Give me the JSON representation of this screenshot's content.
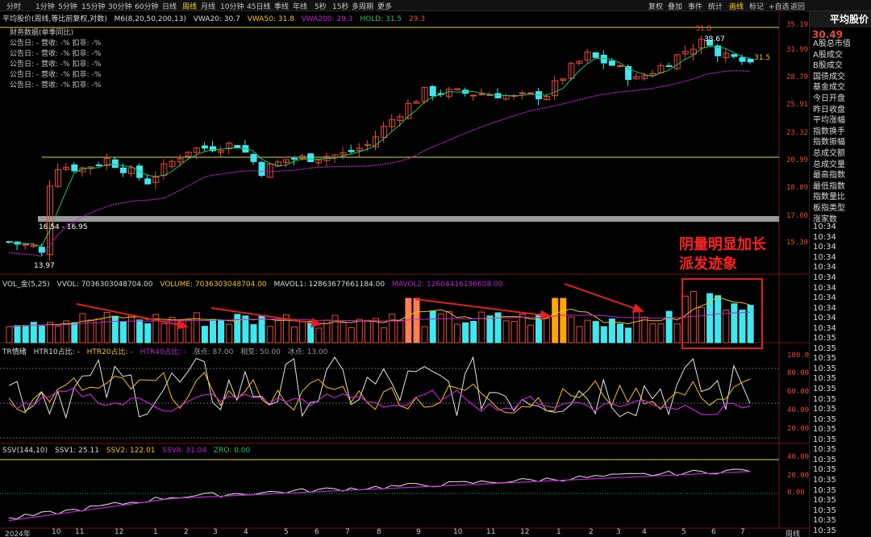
{
  "toolbar": {
    "left": [
      "分时",
      "1分钟",
      "5分钟",
      "15分钟",
      "30分钟",
      "60分钟",
      "日线",
      "周线",
      "月线",
      "10分钟",
      "45日线",
      "季线",
      "年线",
      "5秒",
      "15秒",
      "多周期",
      "更多"
    ],
    "active": "周线",
    "right": [
      "复权",
      "叠加",
      "事件",
      "统计",
      "画线",
      "标记",
      "+自选",
      "返回"
    ]
  },
  "main": {
    "title": "平均股价(周线,等比前复权,对数)",
    "indicator": "M6(8,20,50,200,13)",
    "vwa20": "VWA20: 30.7",
    "vwa50": "VWA50: 31.8",
    "vwa200": "VWA200: 29.3",
    "hold": "HOLD: 31.5",
    "extra": "29.3",
    "fin_header": "财务数据(单季同比)",
    "fin_rows": [
      "公告日: -    营收: -%    扣非: -%",
      "公告日: -    营收: -%    扣非: -%",
      "公告日: -    营收: -%    扣非: -%",
      "公告日: -    营收: -%    扣非: -%",
      "公告日: -    营收: -%    扣非: -%"
    ],
    "range_label": "16.54 - 16.95",
    "low_label": "13.97",
    "high_label": "31.8",
    "high2_label": "33.67",
    "last_label": "31.5",
    "price_axis": [
      "35.19",
      "31.99",
      "28.79",
      "25.91",
      "23.32",
      "20.99",
      "18.89",
      "17.00",
      "15.30"
    ]
  },
  "volume": {
    "title": "VOL_金(5,25)",
    "vvol": "VVOL: 7036303048704.00",
    "volume": "VOLUME: 7036303048704.00",
    "mavol1": "MAVOL1: 12863677661184.00",
    "mavol2": "MAVOL2: 12604416196608.00"
  },
  "tr": {
    "title": "TR情绪",
    "h10": "HTR10占比: -",
    "h20": "HTR20占比: -",
    "h40": "HTR40占比: -",
    "up": "涨点: 87.00",
    "mid": "相变: 50.00",
    "ice": "冰点: 13.00",
    "axis": [
      "100.0",
      "80.00",
      "60.00",
      "40.00",
      "20.00"
    ]
  },
  "ssv": {
    "title": "SSV(144,10)",
    "ssv1": "SSV1: 25.11",
    "ssv2": "SSV2: 122.01",
    "ssva": "SSVA: 31.04",
    "zro": "ZRO: 0.00",
    "axis": [
      "40.00",
      "20.00",
      "0.00"
    ]
  },
  "annotation": {
    "line1": "阴量明显加长",
    "line2": "派发迹象"
  },
  "right_panel": {
    "title": "平均股价",
    "price": "30.49",
    "items": [
      "A股总市值",
      "A股成交",
      "B股成交",
      "国债成交",
      "基金成交",
      "今日开盘",
      "昨日收盘",
      "平均涨幅",
      "指数换手",
      "指数振幅",
      "总成交额",
      "总成交量",
      "最高指数",
      "最低指数",
      "指数量比",
      "板指类型",
      "涨家数"
    ],
    "times": [
      "10:34",
      "10:34",
      "10:34",
      "10:34",
      "10:34",
      "10:34",
      "10:34",
      "10:34",
      "10:34",
      "10:34",
      "10:34",
      "10:35",
      "10:35",
      "10:35",
      "10:35",
      "10:35",
      "10:35",
      "10:35",
      "10:35",
      "10:35",
      "10:35",
      "10:35",
      "10:35",
      "10:35",
      "10:35",
      "10:35",
      "10:35",
      "10:35",
      "10:35",
      "10:35",
      "10:35",
      "10:35",
      "10:35",
      "10:35",
      "10:35",
      "10:35"
    ]
  },
  "x_axis": [
    "2024年",
    "10",
    "11",
    "12",
    "1",
    "2",
    "3",
    "4",
    "5",
    "6",
    "7",
    "8",
    "9",
    "10",
    "11",
    "12",
    "1",
    "2",
    "3",
    "4",
    "5",
    "6",
    "7"
  ],
  "x_axis_right": "周线",
  "colors": {
    "up": "#e74c3c",
    "down": "#3ee8f0",
    "vwa20": "#22c55e",
    "vwa50": "#f5c518",
    "vwa200": "#c026d3",
    "hold": "#22c55e"
  },
  "chart_data": {
    "type": "candlestick",
    "series": [
      {
        "name": "K线",
        "ohlc_summary": "weekly candles rising from 13.97 low to 33.67 high"
      }
    ]
  }
}
